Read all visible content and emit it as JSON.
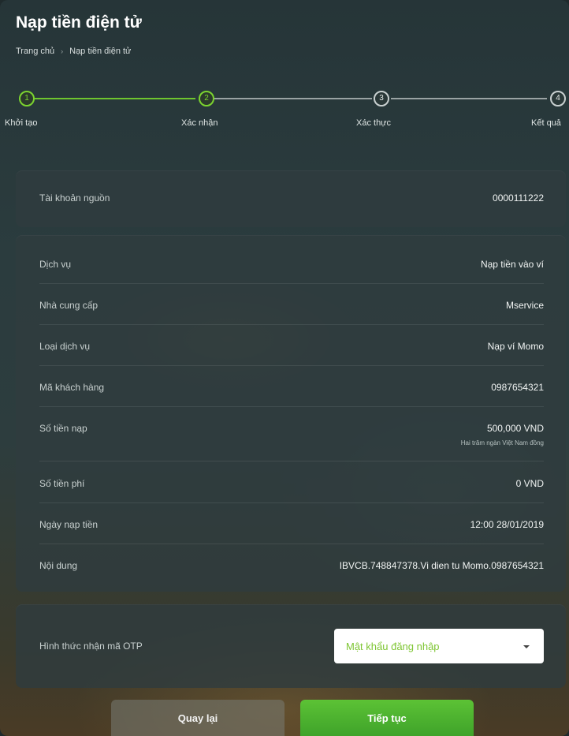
{
  "header": {
    "title": "Nạp tiền điện tử",
    "breadcrumb": [
      "Trang chủ",
      "Nạp tiền điện tử"
    ]
  },
  "stepper": {
    "steps": [
      {
        "number": "1",
        "label": "Khởi tạo",
        "done": true
      },
      {
        "number": "2",
        "label": "Xác nhận",
        "done": true
      },
      {
        "number": "3",
        "label": "Xác thực",
        "done": false
      },
      {
        "number": "4",
        "label": "Kết quả",
        "done": false
      }
    ]
  },
  "source_account": {
    "label": "Tài khoản nguồn",
    "value": "0000111222"
  },
  "details": [
    {
      "label": "Dịch vụ",
      "value": "Nạp tiền vào ví"
    },
    {
      "label": "Nhà cung cấp",
      "value": "Mservice"
    },
    {
      "label": "Loại dịch vụ",
      "value": "Nạp ví Momo"
    },
    {
      "label": "Mã khách hàng",
      "value": "0987654321"
    },
    {
      "label": "Số tiền nạp",
      "value": "500,000 VND",
      "sub": "Hai trăm ngàn Việt Nam đồng"
    },
    {
      "label": "Số tiền phí",
      "value": "0 VND"
    },
    {
      "label": "Ngày nạp tiền",
      "value": "12:00 28/01/2019"
    },
    {
      "label": "Nội dung",
      "value": "IBVCB.748847378.Vi dien tu Momo.0987654321"
    }
  ],
  "otp": {
    "label": "Hình thức nhận mã OTP",
    "selected": "Mật khẩu đăng nhập"
  },
  "buttons": {
    "back": "Quay lại",
    "next": "Tiếp tục"
  },
  "colors": {
    "accent": "#7bd32f",
    "primary_button": "#4caf2f"
  }
}
